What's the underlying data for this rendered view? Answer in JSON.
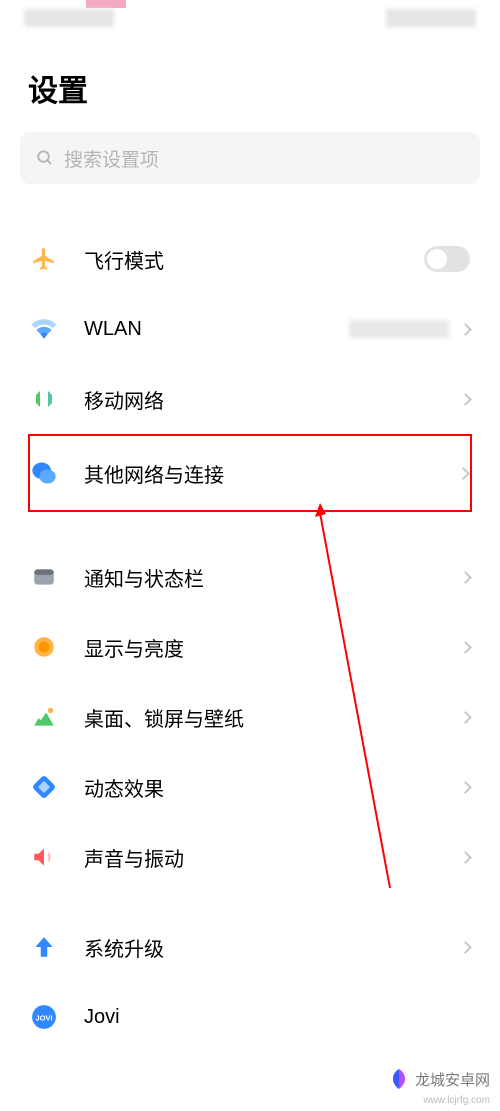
{
  "page": {
    "title": "设置"
  },
  "search": {
    "placeholder": "搜索设置项"
  },
  "items": {
    "airplane": "飞行模式",
    "wlan": "WLAN",
    "mobile": "移动网络",
    "other_network": "其他网络与连接",
    "notification": "通知与状态栏",
    "display": "显示与亮度",
    "desktop": "桌面、锁屏与壁纸",
    "effects": "动态效果",
    "sound": "声音与振动",
    "upgrade": "系统升级",
    "jovi": "Jovi"
  },
  "watermark": {
    "text": "龙城安卓网",
    "url": "www.lcjrfg.com"
  }
}
